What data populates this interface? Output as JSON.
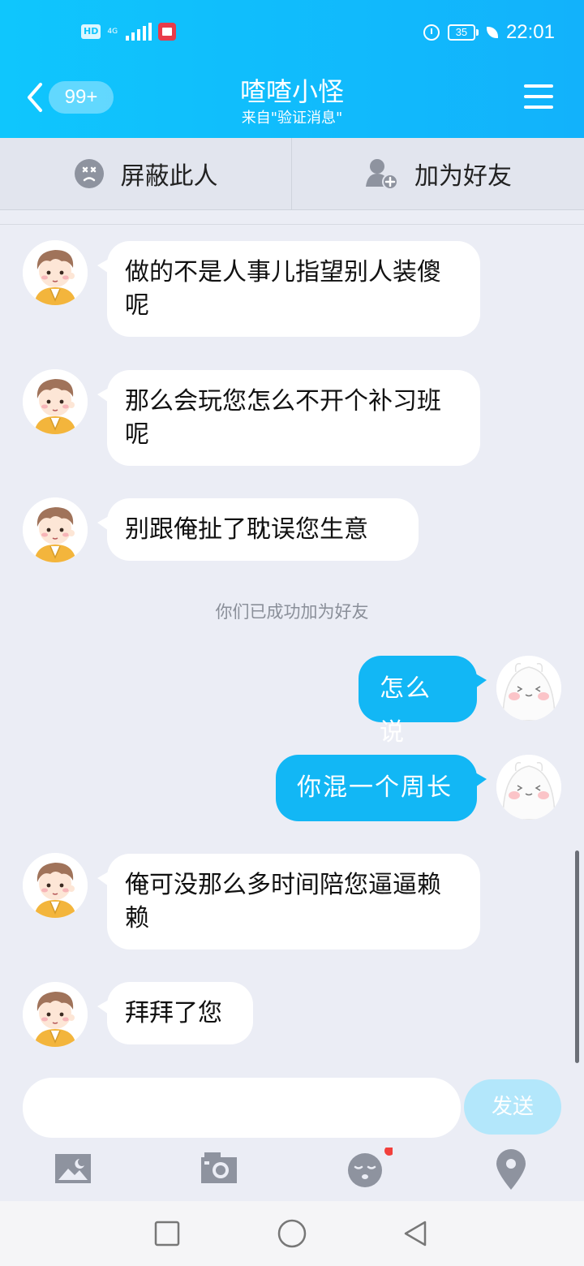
{
  "status_bar": {
    "hd_label": "HD",
    "network_label": "4G",
    "battery_level": "35",
    "time": "22:01"
  },
  "header": {
    "unread_badge": "99+",
    "title": "喳喳小怪",
    "subtitle": "来自\"验证消息\""
  },
  "action_bar": {
    "block_label": "屏蔽此人",
    "add_friend_label": "加为好友"
  },
  "messages": [
    {
      "side": "left",
      "text": "做的不是人事儿指望别人装傻呢"
    },
    {
      "side": "left",
      "text": "那么会玩您怎么不开个补习班呢"
    },
    {
      "side": "left",
      "text": "别跟俺扯了耽误您生意"
    },
    {
      "side": "system",
      "text": "你们已成功加为好友"
    },
    {
      "side": "right",
      "text": "怎么说"
    },
    {
      "side": "right",
      "text": "你混一个周长"
    },
    {
      "side": "left",
      "text": "俺可没那么多时间陪您逼逼赖赖"
    },
    {
      "side": "left",
      "text": "拜拜了您"
    }
  ],
  "composer": {
    "input_value": "",
    "send_label": "发送"
  },
  "colors": {
    "header_start": "#0fc6fd",
    "header_end": "#12b2fb",
    "outgoing_bubble": "#12b7f5",
    "send_button": "#b3e7fb",
    "background": "#ebedf5",
    "notification_dot": "#f2403c"
  },
  "icons": [
    "back-icon",
    "menu-icon",
    "block-icon",
    "add-friend-icon",
    "image-icon",
    "camera-icon",
    "emoji-icon",
    "location-icon",
    "nav-square-icon",
    "nav-home-icon",
    "nav-back-icon"
  ]
}
